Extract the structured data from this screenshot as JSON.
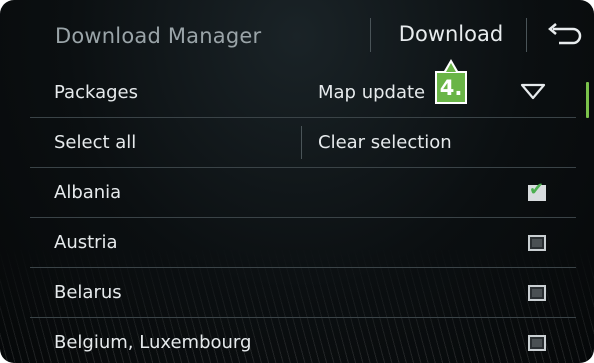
{
  "header": {
    "title": "Download Manager",
    "download_label": "Download"
  },
  "rows": [
    {
      "label": "Packages",
      "value": "Map update"
    },
    {
      "label": "Select all",
      "value": "Clear selection"
    },
    {
      "label": "Albania",
      "checked": true
    },
    {
      "label": "Austria",
      "checked": false
    },
    {
      "label": "Belarus",
      "checked": false
    },
    {
      "label": "Belgium, Luxembourg",
      "checked": false
    }
  ],
  "callout": {
    "label": "4."
  },
  "colors": {
    "accent": "#6ab547",
    "check": "#4caf50"
  }
}
